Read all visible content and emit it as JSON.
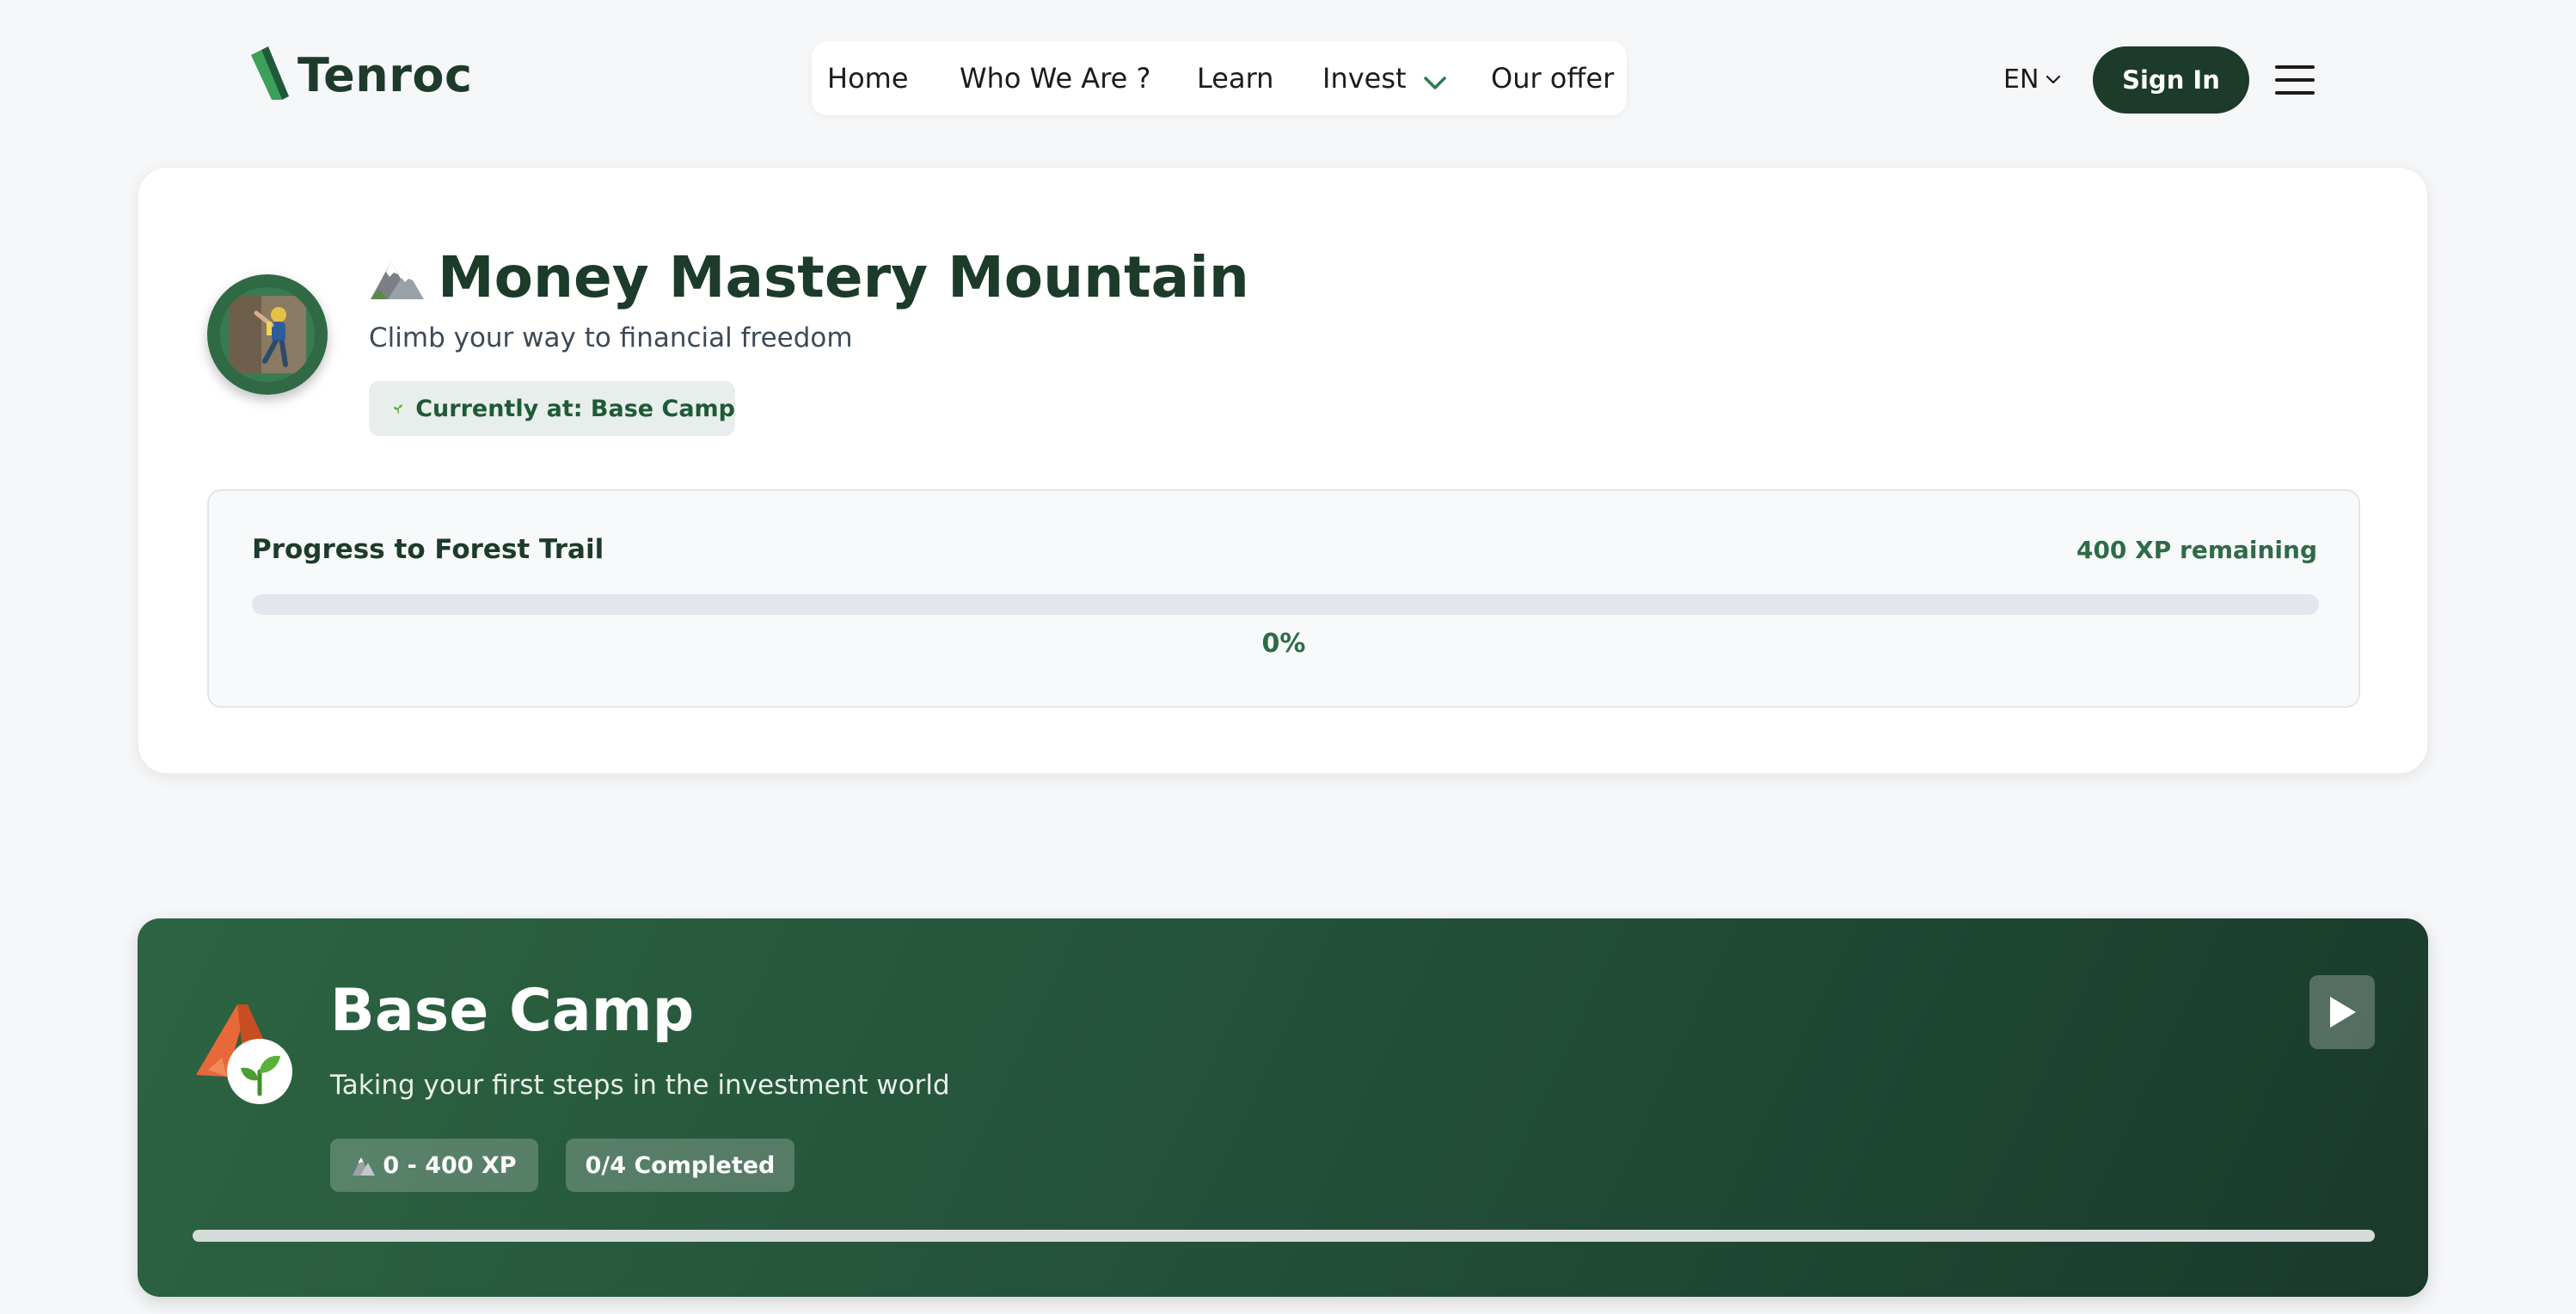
{
  "header": {
    "logo_text": "Tenroc",
    "nav": [
      {
        "label": "Home"
      },
      {
        "label": "Who We Are ?"
      },
      {
        "label": "Learn"
      },
      {
        "label": "Invest"
      },
      {
        "label": "Our offer"
      }
    ],
    "language": "EN",
    "sign_in_label": "Sign In"
  },
  "journey": {
    "title": "Money Mastery Mountain",
    "subtitle": "Climb your way to financial freedom",
    "current_location": "Currently at: Base Camp",
    "progress_label": "Progress to Forest Trail",
    "xp_remaining": "400 XP remaining",
    "progress_percent_text": "0%",
    "progress_fraction": 0
  },
  "stage": {
    "title": "Base Camp",
    "description": "Taking your first steps in the investment world",
    "xp_range": "0 - 400 XP",
    "completed": "0/4 Completed",
    "progress_fraction": 0
  },
  "colors": {
    "brand_dark": "#1c3b2a",
    "brand_green": "#2e6b47",
    "stage_gradient_start": "#2c6441",
    "stage_gradient_end": "#1a3a2b"
  },
  "icons": {
    "logo": "tenroc-logo-icon",
    "nav_dropdown": "chevron-down-icon",
    "menu": "hamburger-icon",
    "journey": "mountain-icon",
    "avatar": "climber-avatar",
    "status": "sprout-icon",
    "stage": "tent-sprout-icon",
    "play": "play-icon"
  }
}
